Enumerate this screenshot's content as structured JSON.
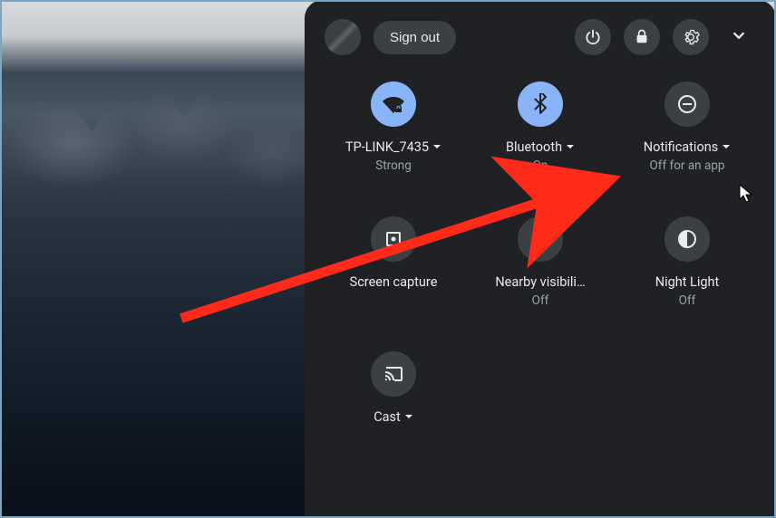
{
  "header": {
    "sign_out": "Sign out"
  },
  "tiles": {
    "wifi": {
      "label": "TP-LINK_7435",
      "status": "Strong",
      "on": true,
      "caret": true
    },
    "bt": {
      "label": "Bluetooth",
      "status": "On",
      "on": true,
      "caret": true
    },
    "notif": {
      "label": "Notifications",
      "status": "Off for an app",
      "on": false,
      "caret": true
    },
    "screen": {
      "label": "Screen capture",
      "status": "",
      "on": false,
      "caret": false
    },
    "nearby": {
      "label": "Nearby visibili…",
      "status": "Off",
      "on": false,
      "caret": false
    },
    "night": {
      "label": "Night Light",
      "status": "Off",
      "on": false,
      "caret": false
    },
    "cast": {
      "label": "Cast",
      "status": "",
      "on": false,
      "caret": true
    }
  },
  "colors": {
    "accent": "#8ab4f8",
    "panel": "#202124",
    "arrow": "#ff2a1a"
  }
}
